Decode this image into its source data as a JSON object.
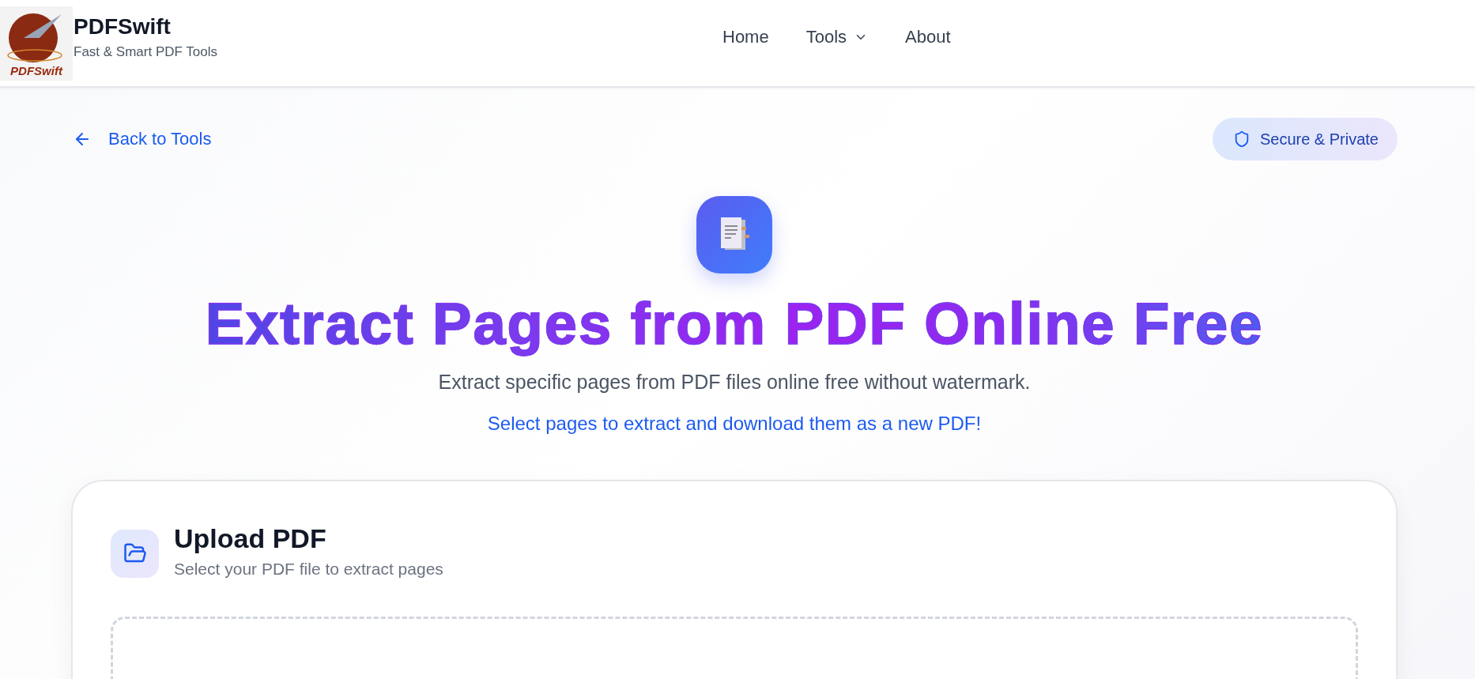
{
  "header": {
    "logo": {
      "text": "PDFSwift"
    },
    "brand": "PDFSwift",
    "tagline": "Fast & Smart PDF Tools",
    "nav": [
      {
        "label": "Home",
        "kind": "link"
      },
      {
        "label": "Tools",
        "kind": "dropdown"
      },
      {
        "label": "About",
        "kind": "link"
      }
    ]
  },
  "back_link": "Back to Tools",
  "badge": "Secure & Private",
  "hero": {
    "title": "Extract Pages from PDF Online Free",
    "subtitle": "Extract specific pages from PDF files online free without watermark.",
    "tagline": "Select pages to extract and download them as a new PDF!"
  },
  "upload_card": {
    "title": "Upload PDF",
    "subtitle": "Select your PDF file to extract pages"
  }
}
